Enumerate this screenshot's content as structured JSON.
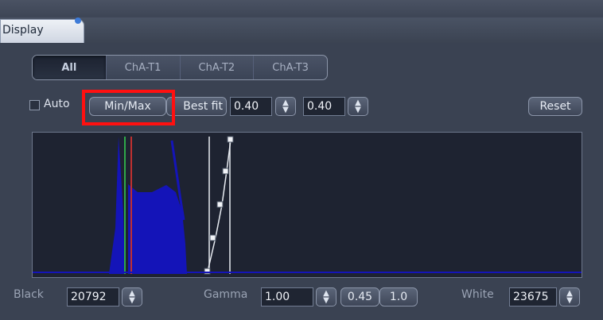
{
  "tabs": {
    "display": "Display"
  },
  "channels": [
    "All",
    "ChA-T1",
    "ChA-T2",
    "ChA-T3"
  ],
  "controls": {
    "auto_label": "Auto",
    "auto_checked": false,
    "minmax_label": "Min/Max",
    "bestfit_label": "Best fit",
    "value1": "0.40",
    "value2": "0.40",
    "reset_label": "Reset"
  },
  "bottom": {
    "black_label": "Black",
    "black_value": "20792",
    "gamma_label": "Gamma",
    "gamma_value": "1.00",
    "preset1": "0.45",
    "preset2": "1.0",
    "white_label": "White",
    "white_value": "23675"
  },
  "colors": {
    "histogram": "#1414b8",
    "highlight": "#ff1010",
    "green_line": "#2ea84a",
    "red_line": "#c03030"
  }
}
